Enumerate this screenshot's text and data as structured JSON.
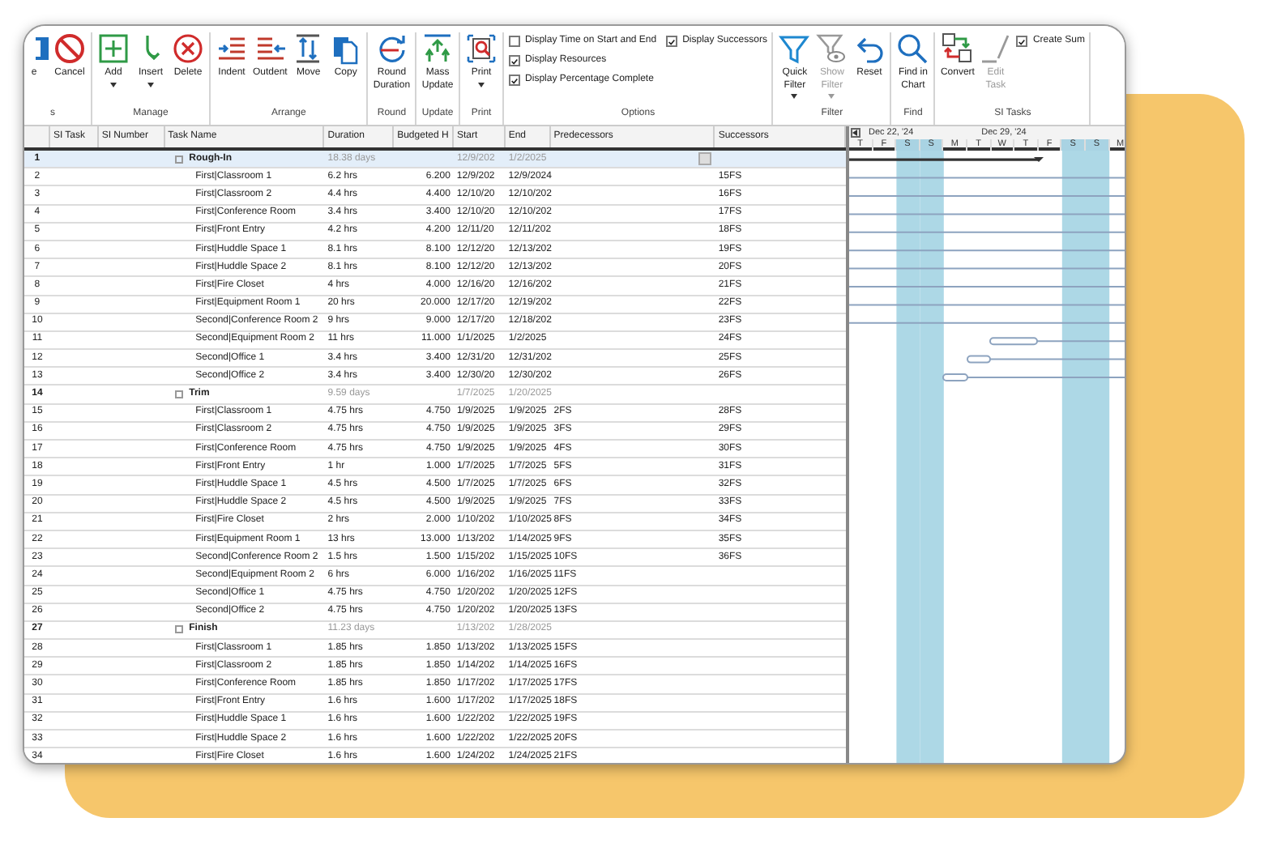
{
  "ribbon": {
    "groups": [
      {
        "label": "s",
        "items": [
          {
            "kind": "button",
            "label": "e"
          },
          {
            "kind": "button",
            "label": "Cancel"
          }
        ]
      },
      {
        "label": "Manage",
        "items": [
          {
            "kind": "button",
            "label": "Add",
            "dropdown": true
          },
          {
            "kind": "button",
            "label": "Insert",
            "dropdown": true
          },
          {
            "kind": "button",
            "label": "Delete"
          }
        ]
      },
      {
        "label": "Arrange",
        "items": [
          {
            "kind": "button",
            "label": "Indent"
          },
          {
            "kind": "button",
            "label": "Outdent"
          },
          {
            "kind": "button",
            "label": "Move"
          },
          {
            "kind": "button",
            "label": "Copy"
          }
        ]
      },
      {
        "label": "Round",
        "items": [
          {
            "kind": "button",
            "label": "Round\nDuration"
          }
        ]
      },
      {
        "label": "Update",
        "items": [
          {
            "kind": "button",
            "label": "Mass\nUpdate"
          }
        ]
      },
      {
        "label": "Print",
        "items": [
          {
            "kind": "button",
            "label": "Print",
            "dropdown": true
          }
        ]
      },
      {
        "label": "Options",
        "items": [
          {
            "kind": "checkrow",
            "checkboxes": [
              {
                "label": "Display Time on Start and End",
                "checked": false
              },
              {
                "label": "Display Successors",
                "checked": true
              }
            ]
          },
          {
            "kind": "checkrow",
            "checkboxes": [
              {
                "label": "Display Resources",
                "checked": true
              }
            ]
          },
          {
            "kind": "checkrow",
            "checkboxes": [
              {
                "label": "Display Percentage Complete",
                "checked": true
              }
            ]
          }
        ]
      },
      {
        "label": "Filter",
        "items": [
          {
            "kind": "button",
            "label": "Quick\nFilter",
            "dropdown": true
          },
          {
            "kind": "button",
            "label": "Show\nFilter",
            "dropdown": true,
            "disabled": true
          },
          {
            "kind": "button",
            "label": "Reset"
          }
        ]
      },
      {
        "label": "Find",
        "items": [
          {
            "kind": "button",
            "label": "Find in\nChart"
          }
        ]
      },
      {
        "label": "SI Tasks",
        "items": [
          {
            "kind": "button",
            "label": "Convert"
          },
          {
            "kind": "button",
            "label": "Edit\nTask",
            "disabled": true
          },
          {
            "kind": "checkrow",
            "checkboxes": [
              {
                "label": "Create Sum",
                "checked": true
              }
            ]
          }
        ]
      }
    ]
  },
  "table": {
    "columns": [
      "SI Task",
      "SI Number",
      "Task Name",
      "Duration",
      "Budgeted H",
      "Start",
      "End",
      "Predecessors",
      "Successors"
    ],
    "rows": [
      {
        "id": "1",
        "summary": true,
        "selected": true,
        "name": "Rough-In",
        "duration": "18.38 days",
        "budgeted": "",
        "start": "12/9/202",
        "end": "1/2/2025",
        "predecessors": "",
        "successors": ""
      },
      {
        "id": "2",
        "summary": false,
        "selected": false,
        "name": "First|Classroom 1",
        "duration": "6.2 hrs",
        "budgeted": "6.200",
        "start": "12/9/202",
        "end": "12/9/2024",
        "predecessors": "",
        "successors": "15FS"
      },
      {
        "id": "3",
        "summary": false,
        "selected": false,
        "name": "First|Classroom 2",
        "duration": "4.4 hrs",
        "budgeted": "4.400",
        "start": "12/10/20",
        "end": "12/10/202",
        "predecessors": "",
        "successors": "16FS"
      },
      {
        "id": "4",
        "summary": false,
        "selected": false,
        "name": "First|Conference Room",
        "duration": "3.4 hrs",
        "budgeted": "3.400",
        "start": "12/10/20",
        "end": "12/10/202",
        "predecessors": "",
        "successors": "17FS"
      },
      {
        "id": "5",
        "summary": false,
        "selected": false,
        "name": "First|Front Entry",
        "duration": "4.2 hrs",
        "budgeted": "4.200",
        "start": "12/11/20",
        "end": "12/11/202",
        "predecessors": "",
        "successors": "18FS"
      },
      {
        "id": "6",
        "summary": false,
        "selected": false,
        "name": "First|Huddle Space 1",
        "duration": "8.1 hrs",
        "budgeted": "8.100",
        "start": "12/12/20",
        "end": "12/13/202",
        "predecessors": "",
        "successors": "19FS"
      },
      {
        "id": "7",
        "summary": false,
        "selected": false,
        "name": "First|Huddle Space 2",
        "duration": "8.1 hrs",
        "budgeted": "8.100",
        "start": "12/12/20",
        "end": "12/13/202",
        "predecessors": "",
        "successors": "20FS"
      },
      {
        "id": "8",
        "summary": false,
        "selected": false,
        "name": "First|Fire Closet",
        "duration": "4 hrs",
        "budgeted": "4.000",
        "start": "12/16/20",
        "end": "12/16/202",
        "predecessors": "",
        "successors": "21FS"
      },
      {
        "id": "9",
        "summary": false,
        "selected": false,
        "name": "First|Equipment Room 1",
        "duration": "20 hrs",
        "budgeted": "20.000",
        "start": "12/17/20",
        "end": "12/19/202",
        "predecessors": "",
        "successors": "22FS"
      },
      {
        "id": "10",
        "summary": false,
        "selected": false,
        "name": "Second|Conference Room 2",
        "duration": "9 hrs",
        "budgeted": "9.000",
        "start": "12/17/20",
        "end": "12/18/202",
        "predecessors": "",
        "successors": "23FS"
      },
      {
        "id": "11",
        "summary": false,
        "selected": false,
        "name": "Second|Equipment Room 2",
        "duration": "11 hrs",
        "budgeted": "11.000",
        "start": "1/1/2025",
        "end": "1/2/2025",
        "predecessors": "",
        "successors": "24FS"
      },
      {
        "id": "12",
        "summary": false,
        "selected": false,
        "name": "Second|Office 1",
        "duration": "3.4 hrs",
        "budgeted": "3.400",
        "start": "12/31/20",
        "end": "12/31/202",
        "predecessors": "",
        "successors": "25FS"
      },
      {
        "id": "13",
        "summary": false,
        "selected": false,
        "name": "Second|Office 2",
        "duration": "3.4 hrs",
        "budgeted": "3.400",
        "start": "12/30/20",
        "end": "12/30/202",
        "predecessors": "",
        "successors": "26FS"
      },
      {
        "id": "14",
        "summary": true,
        "selected": false,
        "name": "Trim",
        "duration": "9.59 days",
        "budgeted": "",
        "start": "1/7/2025",
        "end": "1/20/2025",
        "predecessors": "",
        "successors": ""
      },
      {
        "id": "15",
        "summary": false,
        "selected": false,
        "name": "First|Classroom 1",
        "duration": "4.75 hrs",
        "budgeted": "4.750",
        "start": "1/9/2025",
        "end": "1/9/2025",
        "predecessors": "2FS",
        "successors": "28FS"
      },
      {
        "id": "16",
        "summary": false,
        "selected": false,
        "name": "First|Classroom 2",
        "duration": "4.75 hrs",
        "budgeted": "4.750",
        "start": "1/9/2025",
        "end": "1/9/2025",
        "predecessors": "3FS",
        "successors": "29FS"
      },
      {
        "id": "17",
        "summary": false,
        "selected": false,
        "name": "First|Conference Room",
        "duration": "4.75 hrs",
        "budgeted": "4.750",
        "start": "1/9/2025",
        "end": "1/9/2025",
        "predecessors": "4FS",
        "successors": "30FS"
      },
      {
        "id": "18",
        "summary": false,
        "selected": false,
        "name": "First|Front Entry",
        "duration": "1 hr",
        "budgeted": "1.000",
        "start": "1/7/2025",
        "end": "1/7/2025",
        "predecessors": "5FS",
        "successors": "31FS"
      },
      {
        "id": "19",
        "summary": false,
        "selected": false,
        "name": "First|Huddle Space 1",
        "duration": "4.5 hrs",
        "budgeted": "4.500",
        "start": "1/7/2025",
        "end": "1/7/2025",
        "predecessors": "6FS",
        "successors": "32FS"
      },
      {
        "id": "20",
        "summary": false,
        "selected": false,
        "name": "First|Huddle Space 2",
        "duration": "4.5 hrs",
        "budgeted": "4.500",
        "start": "1/9/2025",
        "end": "1/9/2025",
        "predecessors": "7FS",
        "successors": "33FS"
      },
      {
        "id": "21",
        "summary": false,
        "selected": false,
        "name": "First|Fire Closet",
        "duration": "2 hrs",
        "budgeted": "2.000",
        "start": "1/10/202",
        "end": "1/10/2025",
        "predecessors": "8FS",
        "successors": "34FS"
      },
      {
        "id": "22",
        "summary": false,
        "selected": false,
        "name": "First|Equipment Room 1",
        "duration": "13 hrs",
        "budgeted": "13.000",
        "start": "1/13/202",
        "end": "1/14/2025",
        "predecessors": "9FS",
        "successors": "35FS"
      },
      {
        "id": "23",
        "summary": false,
        "selected": false,
        "name": "Second|Conference Room 2",
        "duration": "1.5 hrs",
        "budgeted": "1.500",
        "start": "1/15/202",
        "end": "1/15/2025",
        "predecessors": "10FS",
        "successors": "36FS"
      },
      {
        "id": "24",
        "summary": false,
        "selected": false,
        "name": "Second|Equipment Room 2",
        "duration": "6 hrs",
        "budgeted": "6.000",
        "start": "1/16/202",
        "end": "1/16/2025",
        "predecessors": "11FS",
        "successors": ""
      },
      {
        "id": "25",
        "summary": false,
        "selected": false,
        "name": "Second|Office 1",
        "duration": "4.75 hrs",
        "budgeted": "4.750",
        "start": "1/20/202",
        "end": "1/20/2025",
        "predecessors": "12FS",
        "successors": ""
      },
      {
        "id": "26",
        "summary": false,
        "selected": false,
        "name": "Second|Office 2",
        "duration": "4.75 hrs",
        "budgeted": "4.750",
        "start": "1/20/202",
        "end": "1/20/2025",
        "predecessors": "13FS",
        "successors": ""
      },
      {
        "id": "27",
        "summary": true,
        "selected": false,
        "name": "Finish",
        "duration": "11.23 days",
        "budgeted": "",
        "start": "1/13/202",
        "end": "1/28/2025",
        "predecessors": "",
        "successors": ""
      },
      {
        "id": "28",
        "summary": false,
        "selected": false,
        "name": "First|Classroom 1",
        "duration": "1.85 hrs",
        "budgeted": "1.850",
        "start": "1/13/202",
        "end": "1/13/2025",
        "predecessors": "15FS",
        "successors": ""
      },
      {
        "id": "29",
        "summary": false,
        "selected": false,
        "name": "First|Classroom 2",
        "duration": "1.85 hrs",
        "budgeted": "1.850",
        "start": "1/14/202",
        "end": "1/14/2025",
        "predecessors": "16FS",
        "successors": ""
      },
      {
        "id": "30",
        "summary": false,
        "selected": false,
        "name": "First|Conference Room",
        "duration": "1.85 hrs",
        "budgeted": "1.850",
        "start": "1/17/202",
        "end": "1/17/2025",
        "predecessors": "17FS",
        "successors": ""
      },
      {
        "id": "31",
        "summary": false,
        "selected": false,
        "name": "First|Front Entry",
        "duration": "1.6 hrs",
        "budgeted": "1.600",
        "start": "1/17/202",
        "end": "1/17/2025",
        "predecessors": "18FS",
        "successors": ""
      },
      {
        "id": "32",
        "summary": false,
        "selected": false,
        "name": "First|Huddle Space 1",
        "duration": "1.6 hrs",
        "budgeted": "1.600",
        "start": "1/22/202",
        "end": "1/22/2025",
        "predecessors": "19FS",
        "successors": ""
      },
      {
        "id": "33",
        "summary": false,
        "selected": false,
        "name": "First|Huddle Space 2",
        "duration": "1.6 hrs",
        "budgeted": "1.600",
        "start": "1/22/202",
        "end": "1/22/2025",
        "predecessors": "20FS",
        "successors": ""
      },
      {
        "id": "34",
        "summary": false,
        "selected": false,
        "name": "First|Fire Closet",
        "duration": "1.6 hrs",
        "budgeted": "1.600",
        "start": "1/24/202",
        "end": "1/24/2025",
        "predecessors": "21FS",
        "successors": ""
      }
    ]
  },
  "gantt": {
    "weeks": [
      "Dec 22, '24",
      "Dec 29, '24"
    ],
    "days": [
      {
        "label": "T",
        "weekend": false
      },
      {
        "label": "F",
        "weekend": false
      },
      {
        "label": "S",
        "weekend": true
      },
      {
        "label": "S",
        "weekend": true
      },
      {
        "label": "M",
        "weekend": false
      },
      {
        "label": "T",
        "weekend": false
      },
      {
        "label": "W",
        "weekend": false
      },
      {
        "label": "T",
        "weekend": false
      },
      {
        "label": "F",
        "weekend": false
      },
      {
        "label": "S",
        "weekend": true
      },
      {
        "label": "S",
        "weekend": true
      },
      {
        "label": "M",
        "weekend": false
      }
    ]
  }
}
